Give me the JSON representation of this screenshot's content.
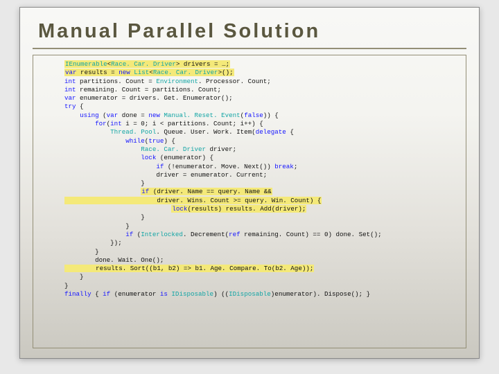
{
  "title": "Manual Parallel Solution",
  "code": {
    "l1_a": "IEnumerable",
    "l1_b": "<",
    "l1_c": "Race. Car. Driver",
    "l1_d": "> drivers = …;",
    "l2_a": "var",
    "l2_b": " results = ",
    "l2_c": "new",
    "l2_d": " ",
    "l2_e": "List",
    "l2_f": "<",
    "l2_g": "Race. Car. Driver",
    "l2_h": ">();",
    "l3_a": "int",
    "l3_b": " partitions. Count = ",
    "l3_c": "Environment",
    "l3_d": ". Processor. Count;",
    "l4_a": "int",
    "l4_b": " remaining. Count = partitions. Count;",
    "l5_a": "var",
    "l5_b": " enumerator = drivers. Get. Enumerator();",
    "l6_a": "try",
    "l6_b": " {",
    "l7_a": "    ",
    "l7_b": "using",
    "l7_c": " (",
    "l7_d": "var",
    "l7_e": " done = ",
    "l7_f": "new",
    "l7_g": " ",
    "l7_h": "Manual. Reset. Event",
    "l7_i": "(",
    "l7_j": "false",
    "l7_k": ")) {",
    "l8_a": "        ",
    "l8_b": "for",
    "l8_c": "(",
    "l8_d": "int",
    "l8_e": " i = 0; i < partitions. Count; i++) {",
    "l9_a": "            ",
    "l9_b": "Thread. Pool",
    "l9_c": ". Queue. User. Work. Item(",
    "l9_d": "delegate",
    "l9_e": " {",
    "l10_a": "                ",
    "l10_b": "while",
    "l10_c": "(",
    "l10_d": "true",
    "l10_e": ") {",
    "l11_a": "                    ",
    "l11_b": "Race. Car. Driver",
    "l11_c": " driver;",
    "l12_a": "                    ",
    "l12_b": "lock",
    "l12_c": " (enumerator) {",
    "l13_a": "                        ",
    "l13_b": "if",
    "l13_c": " (!enumerator. Move. Next()) ",
    "l13_d": "break",
    "l13_e": ";",
    "l14_a": "                        driver = enumerator. Current;",
    "l15_a": "                    }",
    "l16_a": "                    ",
    "l16_b": "if",
    "l16_c": " (driver. Name == query. Name &&",
    "l17_a": "                        driver. Wins. Count >= query. Win. Count) {",
    "l18_a": "                            ",
    "l18_b": "lock",
    "l18_c": "(results) results. Add(driver);",
    "l19_a": "                    }",
    "l20_a": "                }",
    "l21_a": "                ",
    "l21_b": "if",
    "l21_c": " (",
    "l21_d": "Interlocked",
    "l21_e": ". Decrement(",
    "l21_f": "ref",
    "l21_g": " remaining. Count) == 0) done. Set();",
    "l22_a": "            });",
    "l23_a": "        }",
    "l24_a": "        done. Wait. One();",
    "l25_a": "        results. Sort((b1, b2) => b1. Age. Compare. To(b2. Age));",
    "l26_a": "    }",
    "l27_a": "}",
    "l28_a": "finally",
    "l28_b": " { ",
    "l28_c": "if",
    "l28_d": " (enumerator ",
    "l28_e": "is",
    "l28_f": " ",
    "l28_g": "IDisposable",
    "l28_h": ") ((",
    "l28_i": "IDisposable",
    "l28_j": ")enumerator). Dispose(); }"
  }
}
